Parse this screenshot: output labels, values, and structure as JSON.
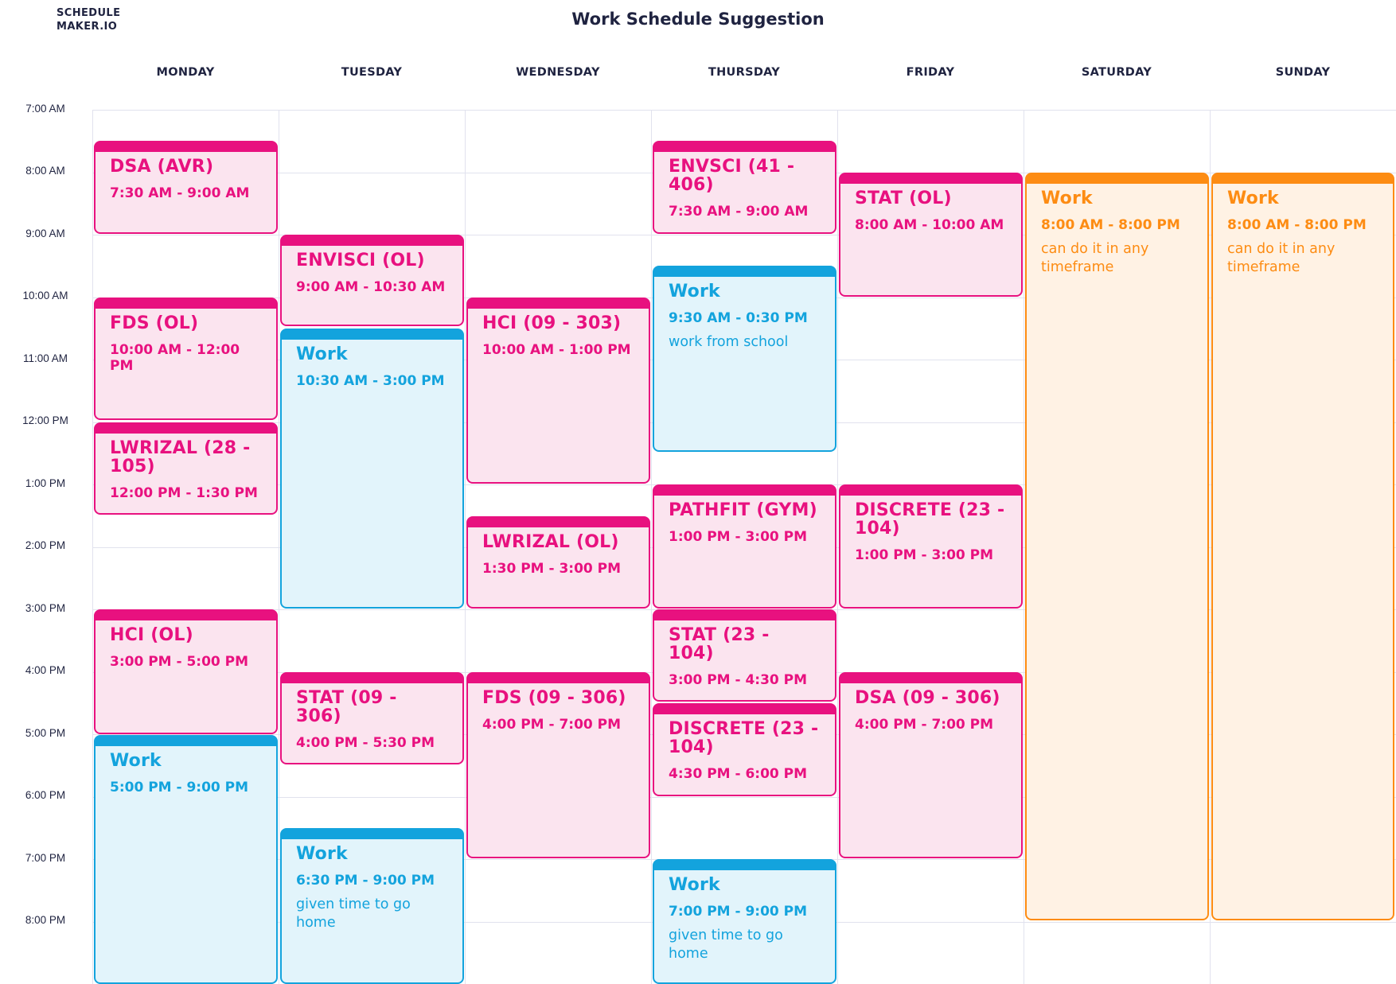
{
  "brand": {
    "line1": "SCHEDULE",
    "line2": "MAKER.IO"
  },
  "title": "Work Schedule Suggestion",
  "days": [
    "MONDAY",
    "TUESDAY",
    "WEDNESDAY",
    "THURSDAY",
    "FRIDAY",
    "SATURDAY",
    "SUNDAY"
  ],
  "times": [
    "7:00 AM",
    "8:00 AM",
    "9:00 AM",
    "10:00 AM",
    "11:00 AM",
    "12:00 PM",
    "1:00 PM",
    "2:00 PM",
    "3:00 PM",
    "4:00 PM",
    "5:00 PM",
    "6:00 PM",
    "7:00 PM",
    "8:00 PM"
  ],
  "colors": {
    "class": "#e8117f",
    "work": "#13a3dd",
    "flexible_work": "#fd8c13",
    "grid": "#e1e2ee",
    "text": "#1f2340"
  },
  "events": {
    "mon1": {
      "title": "DSA (AVR)",
      "time": "7:30 AM - 9:00 AM"
    },
    "mon2": {
      "title": "FDS (OL)",
      "time": "10:00 AM - 12:00 PM"
    },
    "mon3": {
      "title": "LWRIZAL (28 - 105)",
      "time": "12:00 PM - 1:30 PM"
    },
    "mon4": {
      "title": "HCI (OL)",
      "time": "3:00 PM - 5:00 PM"
    },
    "mon5": {
      "title": "Work",
      "time": "5:00 PM - 9:00 PM"
    },
    "tue1": {
      "title": "ENVISCI (OL)",
      "time": "9:00 AM - 10:30 AM"
    },
    "tue2": {
      "title": "Work",
      "time": "10:30 AM - 3:00 PM"
    },
    "tue3": {
      "title": "STAT (09 - 306)",
      "time": "4:00 PM - 5:30 PM"
    },
    "tue4": {
      "title": "Work",
      "time": "6:30 PM - 9:00 PM",
      "note": "given time to go home"
    },
    "wed1": {
      "title": "HCI (09 - 303)",
      "time": "10:00 AM - 1:00 PM"
    },
    "wed2": {
      "title": "LWRIZAL (OL)",
      "time": "1:30 PM - 3:00 PM"
    },
    "wed3": {
      "title": "FDS (09 - 306)",
      "time": "4:00 PM - 7:00 PM"
    },
    "thu1": {
      "title": "ENVSCI (41 - 406)",
      "time": "7:30 AM - 9:00 AM"
    },
    "thu2": {
      "title": "Work",
      "time": "9:30 AM - 0:30 PM",
      "note": "work from school"
    },
    "thu3": {
      "title": "PATHFIT (GYM)",
      "time": "1:00 PM - 3:00 PM"
    },
    "thu4": {
      "title": "STAT (23 - 104)",
      "time": "3:00 PM - 4:30 PM"
    },
    "thu5": {
      "title": "DISCRETE (23 - 104)",
      "time": "4:30 PM - 6:00 PM"
    },
    "thu6": {
      "title": "Work",
      "time": "7:00 PM - 9:00 PM",
      "note": "given time to go home"
    },
    "fri1": {
      "title": "STAT (OL)",
      "time": "8:00 AM - 10:00 AM"
    },
    "fri2": {
      "title": "DISCRETE (23 - 104)",
      "time": "1:00 PM - 3:00 PM"
    },
    "fri3": {
      "title": "DSA (09 - 306)",
      "time": "4:00 PM - 7:00 PM"
    },
    "sat1": {
      "title": "Work",
      "time": "8:00 AM - 8:00 PM",
      "note": "can do it in any timeframe"
    },
    "sun1": {
      "title": "Work",
      "time": "8:00 AM - 8:00 PM",
      "note": "can do it in any timeframe"
    }
  }
}
